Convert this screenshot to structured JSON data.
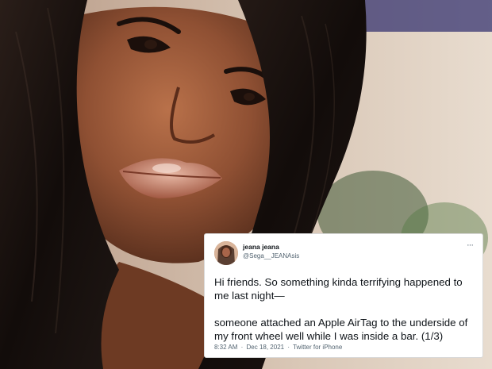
{
  "tweet": {
    "display_name": "jeana jeana",
    "handle": "@Sega__JEANAsis",
    "more_icon": "more-dots-icon",
    "paragraphs": [
      "Hi friends. So something kinda terrifying happened to me last night—",
      "someone attached an Apple AirTag to the underside of my front wheel well while I was inside a bar. (1/3)"
    ],
    "time": "8:32 AM",
    "separator": "·",
    "date": "Dec 18, 2021",
    "source": "Twitter for iPhone"
  },
  "colors": {
    "card_bg": "#ffffff",
    "text_primary": "#0f1419",
    "text_secondary": "#536471",
    "skin": "#8a4f33",
    "hair": "#1a1210",
    "background": "#d8c8b8"
  }
}
